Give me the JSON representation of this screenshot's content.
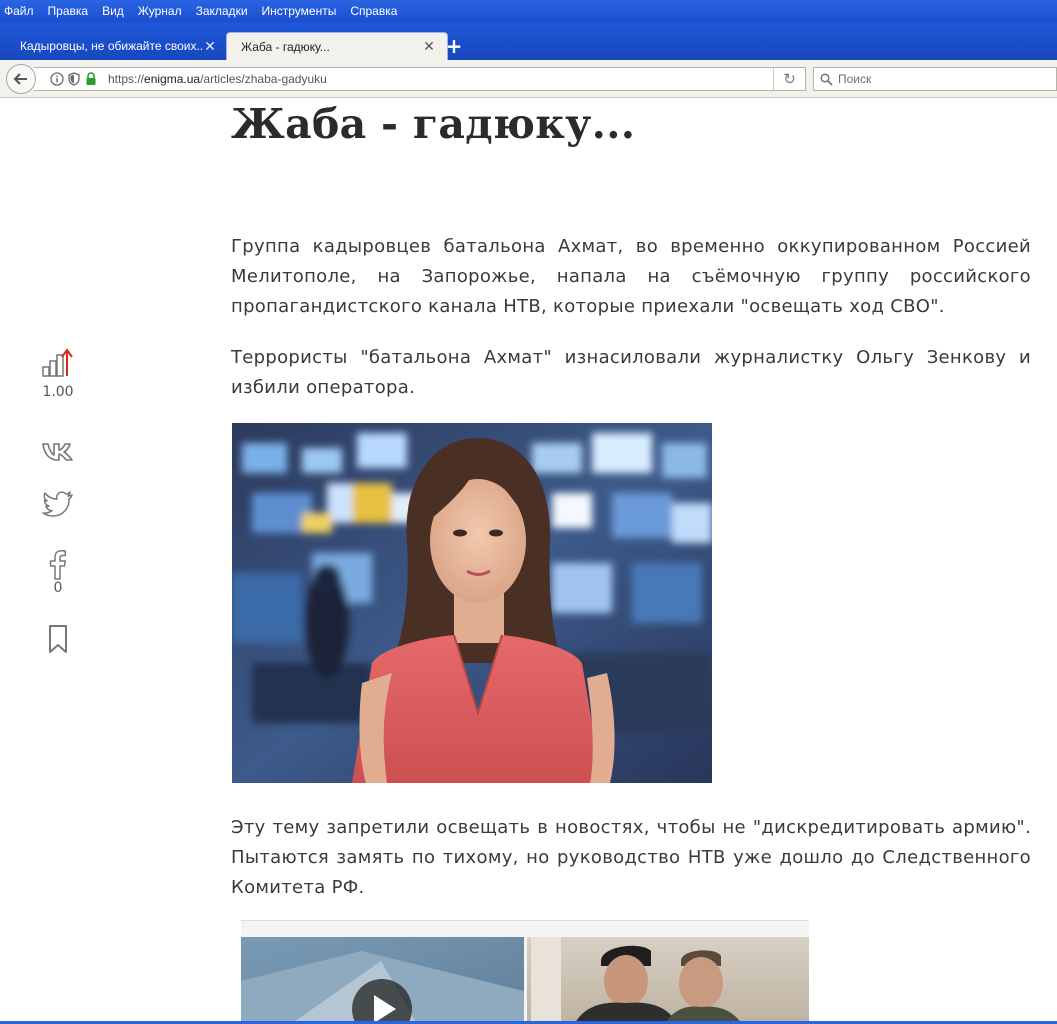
{
  "browser": {
    "menu": [
      "Файл",
      "Правка",
      "Вид",
      "Журнал",
      "Закладки",
      "Инструменты",
      "Справка"
    ],
    "tabs": [
      {
        "label": "Кадыровцы, не обижайте своих...",
        "active": false
      },
      {
        "label": "Жаба - гадюку...",
        "active": true
      }
    ],
    "url_prefix": "https://",
    "url_host": "enigma.ua",
    "url_path": "/articles/zhaba-gadyuku",
    "search_placeholder": "Поиск",
    "accent": "#1e58d9"
  },
  "article": {
    "title": "Жаба - гадюку...",
    "paragraphs": [
      "Группа кадыровцев батальона Ахмат, во временно оккупированном Россией Мелитополе, на Запорожье, напала на съёмочную группу российского пропагандистского канала НТВ, которые приехали \"освещать ход СВО\".",
      "Террористы \"батальона Ахмат\" изнасиловали журналистку Ольгу Зенкову и избили оператора.",
      "Эту тему запретили освещать в новостях, чтобы не \"дискредитировать армию\". Пытаются замять по тихому, но руководство НТВ уже дошло до Следственного Комитета РФ."
    ]
  },
  "sidebar": {
    "rating_icon": "rating-chart-icon",
    "rating_value": "1.00",
    "vk_icon": "vk-icon",
    "twitter_icon": "twitter-icon",
    "facebook_icon": "facebook-icon",
    "facebook_count": "0",
    "bookmark_icon": "bookmark-icon"
  }
}
